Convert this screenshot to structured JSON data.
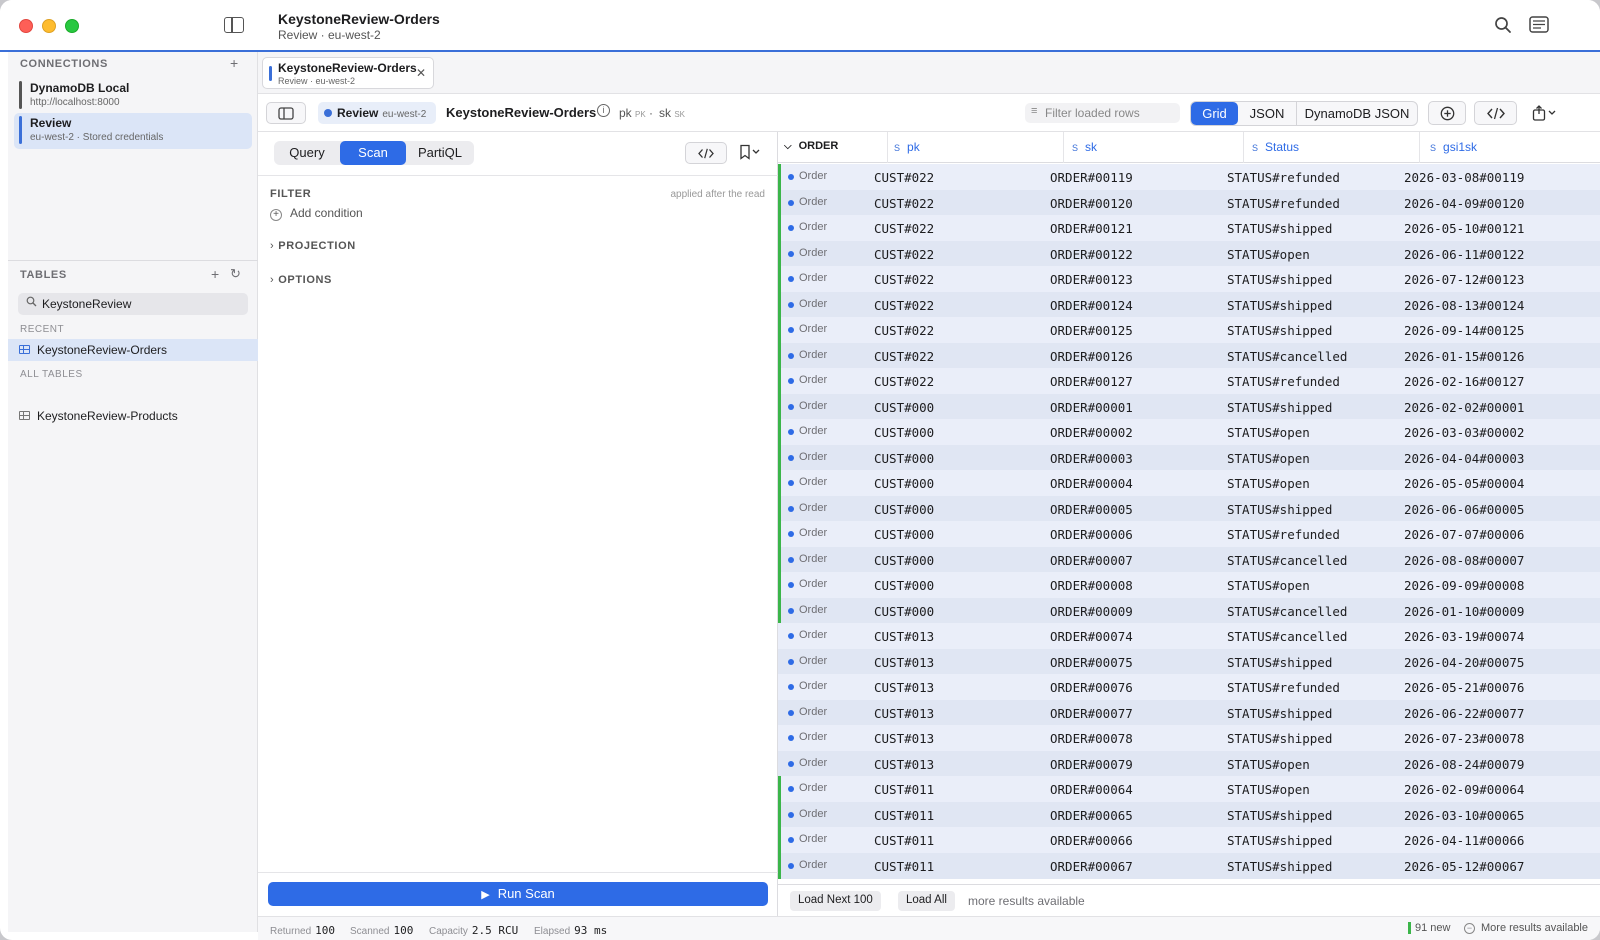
{
  "titlebar": {
    "title": "KeystoneReview-Orders",
    "subtitle": "Review · eu-west-2"
  },
  "sidebar": {
    "connections_header": "CONNECTIONS",
    "connections": [
      {
        "name": "DynamoDB Local",
        "detail": "http://localhost:8000",
        "color": "#555555",
        "selected": false
      },
      {
        "name": "Review",
        "detail": "eu-west-2 · Stored credentials",
        "color": "#3a6fd8",
        "selected": true
      }
    ],
    "tables_header": "TABLES",
    "search_value": "KeystoneReview",
    "recent_label": "RECENT",
    "recent": [
      "KeystoneReview-Orders"
    ],
    "all_label": "ALL TABLES",
    "all": [
      "KeystoneReview-Products"
    ]
  },
  "tab": {
    "title": "KeystoneReview-Orders",
    "subtitle": "Review · eu-west-2"
  },
  "toolbar": {
    "connection": "Review",
    "region": "eu-west-2",
    "table": "KeystoneReview-Orders",
    "pk": "pk",
    "pk_tag": "PK",
    "sk": "sk",
    "sk_tag": "SK",
    "filter_placeholder": "Filter loaded rows",
    "views": [
      "Grid",
      "JSON",
      "DynamoDB JSON"
    ],
    "active_view": "Grid"
  },
  "query": {
    "modes": [
      "Query",
      "Scan",
      "PartiQL"
    ],
    "active_mode": "Scan",
    "filter_label": "FILTER",
    "filter_hint": "applied after the read",
    "add_condition": "Add condition",
    "projection_label": "PROJECTION",
    "options_label": "OPTIONS",
    "run_label": "Run Scan"
  },
  "grid": {
    "group_label": "ORDER",
    "columns": [
      {
        "type": "S",
        "name": "pk"
      },
      {
        "type": "S",
        "name": "sk"
      },
      {
        "type": "S",
        "name": "Status"
      },
      {
        "type": "S",
        "name": "gsi1sk"
      }
    ],
    "rows": [
      {
        "type": "Order",
        "pk": "CUST#022",
        "sk": "ORDER#00119",
        "status": "STATUS#refunded",
        "gsi1sk": "2026-03-08#00119",
        "new": true
      },
      {
        "type": "Order",
        "pk": "CUST#022",
        "sk": "ORDER#00120",
        "status": "STATUS#refunded",
        "gsi1sk": "2026-04-09#00120",
        "new": true
      },
      {
        "type": "Order",
        "pk": "CUST#022",
        "sk": "ORDER#00121",
        "status": "STATUS#shipped",
        "gsi1sk": "2026-05-10#00121",
        "new": true
      },
      {
        "type": "Order",
        "pk": "CUST#022",
        "sk": "ORDER#00122",
        "status": "STATUS#open",
        "gsi1sk": "2026-06-11#00122",
        "new": true
      },
      {
        "type": "Order",
        "pk": "CUST#022",
        "sk": "ORDER#00123",
        "status": "STATUS#shipped",
        "gsi1sk": "2026-07-12#00123",
        "new": true
      },
      {
        "type": "Order",
        "pk": "CUST#022",
        "sk": "ORDER#00124",
        "status": "STATUS#shipped",
        "gsi1sk": "2026-08-13#00124",
        "new": true
      },
      {
        "type": "Order",
        "pk": "CUST#022",
        "sk": "ORDER#00125",
        "status": "STATUS#shipped",
        "gsi1sk": "2026-09-14#00125",
        "new": true
      },
      {
        "type": "Order",
        "pk": "CUST#022",
        "sk": "ORDER#00126",
        "status": "STATUS#cancelled",
        "gsi1sk": "2026-01-15#00126",
        "new": true
      },
      {
        "type": "Order",
        "pk": "CUST#022",
        "sk": "ORDER#00127",
        "status": "STATUS#refunded",
        "gsi1sk": "2026-02-16#00127",
        "new": true
      },
      {
        "type": "Order",
        "pk": "CUST#000",
        "sk": "ORDER#00001",
        "status": "STATUS#shipped",
        "gsi1sk": "2026-02-02#00001",
        "new": true
      },
      {
        "type": "Order",
        "pk": "CUST#000",
        "sk": "ORDER#00002",
        "status": "STATUS#open",
        "gsi1sk": "2026-03-03#00002",
        "new": true
      },
      {
        "type": "Order",
        "pk": "CUST#000",
        "sk": "ORDER#00003",
        "status": "STATUS#open",
        "gsi1sk": "2026-04-04#00003",
        "new": true
      },
      {
        "type": "Order",
        "pk": "CUST#000",
        "sk": "ORDER#00004",
        "status": "STATUS#open",
        "gsi1sk": "2026-05-05#00004",
        "new": true
      },
      {
        "type": "Order",
        "pk": "CUST#000",
        "sk": "ORDER#00005",
        "status": "STATUS#shipped",
        "gsi1sk": "2026-06-06#00005",
        "new": true
      },
      {
        "type": "Order",
        "pk": "CUST#000",
        "sk": "ORDER#00006",
        "status": "STATUS#refunded",
        "gsi1sk": "2026-07-07#00006",
        "new": true
      },
      {
        "type": "Order",
        "pk": "CUST#000",
        "sk": "ORDER#00007",
        "status": "STATUS#cancelled",
        "gsi1sk": "2026-08-08#00007",
        "new": true
      },
      {
        "type": "Order",
        "pk": "CUST#000",
        "sk": "ORDER#00008",
        "status": "STATUS#open",
        "gsi1sk": "2026-09-09#00008",
        "new": true
      },
      {
        "type": "Order",
        "pk": "CUST#000",
        "sk": "ORDER#00009",
        "status": "STATUS#cancelled",
        "gsi1sk": "2026-01-10#00009",
        "new": true
      },
      {
        "type": "Order",
        "pk": "CUST#013",
        "sk": "ORDER#00074",
        "status": "STATUS#cancelled",
        "gsi1sk": "2026-03-19#00074",
        "new": false
      },
      {
        "type": "Order",
        "pk": "CUST#013",
        "sk": "ORDER#00075",
        "status": "STATUS#shipped",
        "gsi1sk": "2026-04-20#00075",
        "new": false
      },
      {
        "type": "Order",
        "pk": "CUST#013",
        "sk": "ORDER#00076",
        "status": "STATUS#refunded",
        "gsi1sk": "2026-05-21#00076",
        "new": false
      },
      {
        "type": "Order",
        "pk": "CUST#013",
        "sk": "ORDER#00077",
        "status": "STATUS#shipped",
        "gsi1sk": "2026-06-22#00077",
        "new": false
      },
      {
        "type": "Order",
        "pk": "CUST#013",
        "sk": "ORDER#00078",
        "status": "STATUS#shipped",
        "gsi1sk": "2026-07-23#00078",
        "new": false
      },
      {
        "type": "Order",
        "pk": "CUST#013",
        "sk": "ORDER#00079",
        "status": "STATUS#open",
        "gsi1sk": "2026-08-24#00079",
        "new": false
      },
      {
        "type": "Order",
        "pk": "CUST#011",
        "sk": "ORDER#00064",
        "status": "STATUS#open",
        "gsi1sk": "2026-02-09#00064",
        "new": true
      },
      {
        "type": "Order",
        "pk": "CUST#011",
        "sk": "ORDER#00065",
        "status": "STATUS#shipped",
        "gsi1sk": "2026-03-10#00065",
        "new": true
      },
      {
        "type": "Order",
        "pk": "CUST#011",
        "sk": "ORDER#00066",
        "status": "STATUS#shipped",
        "gsi1sk": "2026-04-11#00066",
        "new": true
      },
      {
        "type": "Order",
        "pk": "CUST#011",
        "sk": "ORDER#00067",
        "status": "STATUS#shipped",
        "gsi1sk": "2026-05-12#00067",
        "new": true
      }
    ],
    "load_next": "Load Next 100",
    "load_all": "Load All",
    "more_text": "more results available"
  },
  "status": {
    "returned_label": "Returned",
    "returned": "100",
    "scanned_label": "Scanned",
    "scanned": "100",
    "capacity_label": "Capacity",
    "capacity": "2.5 RCU",
    "elapsed_label": "Elapsed",
    "elapsed": "93 ms",
    "new_count": "91 new",
    "more_label": "More results available"
  },
  "colors": {
    "accent": "#2e6be6",
    "new_stripe": "#3bb54a"
  }
}
